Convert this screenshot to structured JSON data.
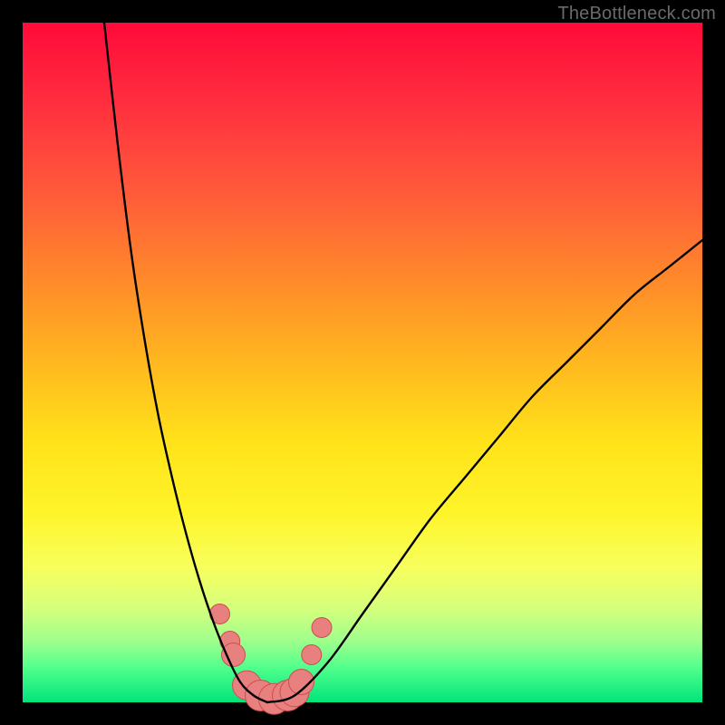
{
  "watermark": "TheBottleneck.com",
  "colors": {
    "background_black": "#000000",
    "gradient_top": "#ff0a3a",
    "gradient_bottom": "#00e47a",
    "curve_stroke": "#000000",
    "marker_fill": "#e98080",
    "marker_stroke": "#c94f4f"
  },
  "chart_data": {
    "type": "line",
    "title": "",
    "xlabel": "",
    "ylabel": "",
    "xlim": [
      0,
      100
    ],
    "ylim": [
      0,
      100
    ],
    "grid": false,
    "legend": false,
    "description": "Bottleneck curve: a steep V-shape whose minimum touches the green zone (near-zero bottleneck) around x≈33–40; left branch rises very steeply toward 100 as x→~12, right branch rises more gently toward ~68 as x→100.",
    "series": [
      {
        "name": "left-branch",
        "x": [
          12,
          14,
          16,
          18,
          20,
          22,
          24,
          26,
          28,
          30,
          32,
          34,
          36
        ],
        "values": [
          100,
          82,
          66,
          53,
          42,
          33,
          25,
          18,
          12,
          7,
          3,
          1,
          0
        ]
      },
      {
        "name": "right-branch",
        "x": [
          36,
          40,
          45,
          50,
          55,
          60,
          65,
          70,
          75,
          80,
          85,
          90,
          95,
          100
        ],
        "values": [
          0,
          1,
          6,
          13,
          20,
          27,
          33,
          39,
          45,
          50,
          55,
          60,
          64,
          68
        ]
      }
    ],
    "markers": {
      "name": "highlight-points",
      "x": [
        29,
        30.5,
        31,
        33,
        35,
        37,
        39,
        40,
        41,
        42.5,
        44
      ],
      "values": [
        13,
        9,
        7,
        2.5,
        1,
        0.5,
        1,
        1.5,
        3,
        7,
        11
      ],
      "size": [
        11,
        11,
        13,
        16,
        17,
        17,
        17,
        16,
        14,
        11,
        11
      ]
    }
  }
}
